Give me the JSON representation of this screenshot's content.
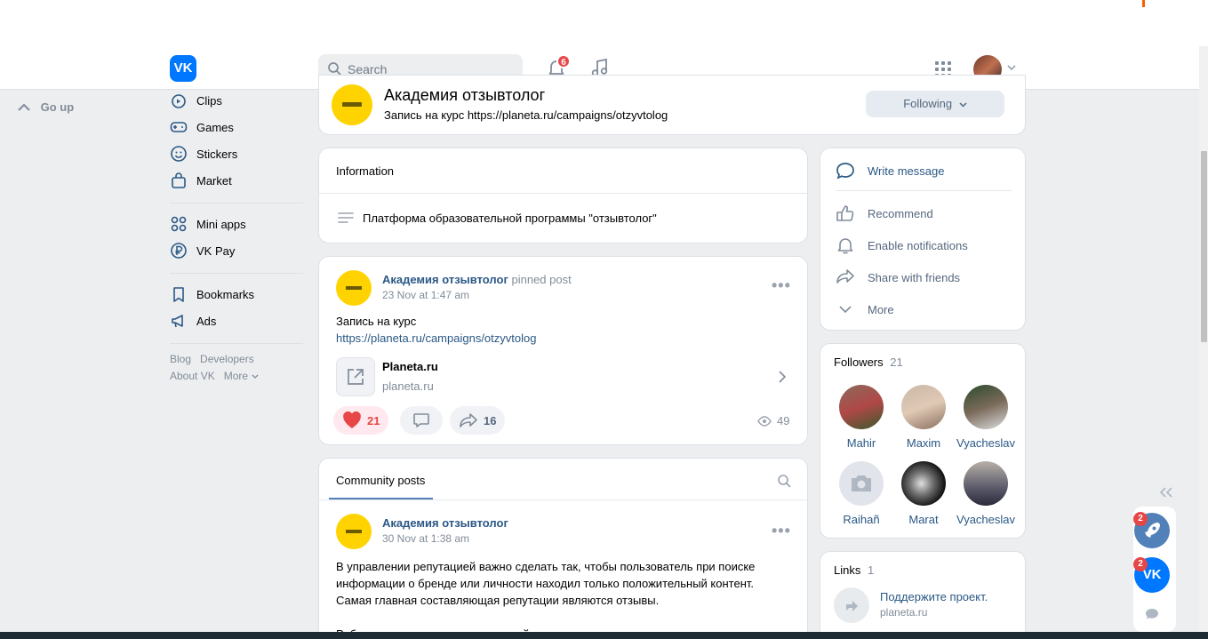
{
  "header": {
    "logo": "VK",
    "search_placeholder": "Search",
    "notifications_count": "6"
  },
  "go_up": "Go up",
  "left_menu": {
    "items": [
      {
        "label": "Clips",
        "icon": "clips-icon"
      },
      {
        "label": "Games",
        "icon": "gamepad-icon"
      },
      {
        "label": "Stickers",
        "icon": "smile-icon"
      },
      {
        "label": "Market",
        "icon": "bag-icon"
      },
      {
        "label": "Mini apps",
        "icon": "grid-icon"
      },
      {
        "label": "VK Pay",
        "icon": "ruble-icon"
      },
      {
        "label": "Bookmarks",
        "icon": "bookmark-icon"
      },
      {
        "label": "Ads",
        "icon": "megaphone-icon"
      }
    ],
    "footer": [
      "Blog",
      "Developers",
      "About VK",
      "More"
    ]
  },
  "community": {
    "name": "Академия отзывтолог",
    "status": "Запись на курс https://planeta.ru/campaigns/otzyvtolog",
    "following_label": "Following"
  },
  "information": {
    "title": "Information",
    "description": "Платформа образовательной программы \"отзывтолог\""
  },
  "pinned_post": {
    "author": "Академия отзывтолог",
    "tag": "pinned post",
    "date": "23 Nov at 1:47 am",
    "text": "Запись на курс",
    "url": "https://planeta.ru/campaigns/otzyvtolog",
    "attachment_title": "Planeta.ru",
    "attachment_domain": "planeta.ru",
    "likes": "21",
    "shares": "16",
    "views": "49"
  },
  "community_posts": {
    "tab": "Community posts",
    "post": {
      "author": "Академия отзывтолог",
      "date": "30 Nov at 1:38 am",
      "text_line1": "В управлении репутацией важно сделать так, чтобы пользователь при поиске",
      "text_line2": "информации о бренде или личности находил только положительный контент.",
      "text_line3": "Самая главная составляющая репутации являются отзывы.",
      "text_line4": "Работая с управлением репутацией, я заметил, что нет специалистов по"
    }
  },
  "actions": {
    "write_message": "Write message",
    "recommend": "Recommend",
    "enable_notifications": "Enable notifications",
    "share": "Share with friends",
    "more": "More"
  },
  "followers": {
    "title": "Followers",
    "count": "21",
    "people": [
      "Mahir",
      "Maxim",
      "Vyacheslav",
      "Raihañ",
      "Marat",
      "Vyacheslav"
    ]
  },
  "links": {
    "title": "Links",
    "count": "1",
    "item_title": "Поддержите проект.",
    "item_domain": "planeta.ru"
  },
  "widget": {
    "badge1": "2",
    "badge2": "2"
  },
  "colors": {
    "accent": "#0077ff",
    "link": "#2a5885",
    "page_bg": "#edeef0",
    "badge": "#e64646"
  }
}
